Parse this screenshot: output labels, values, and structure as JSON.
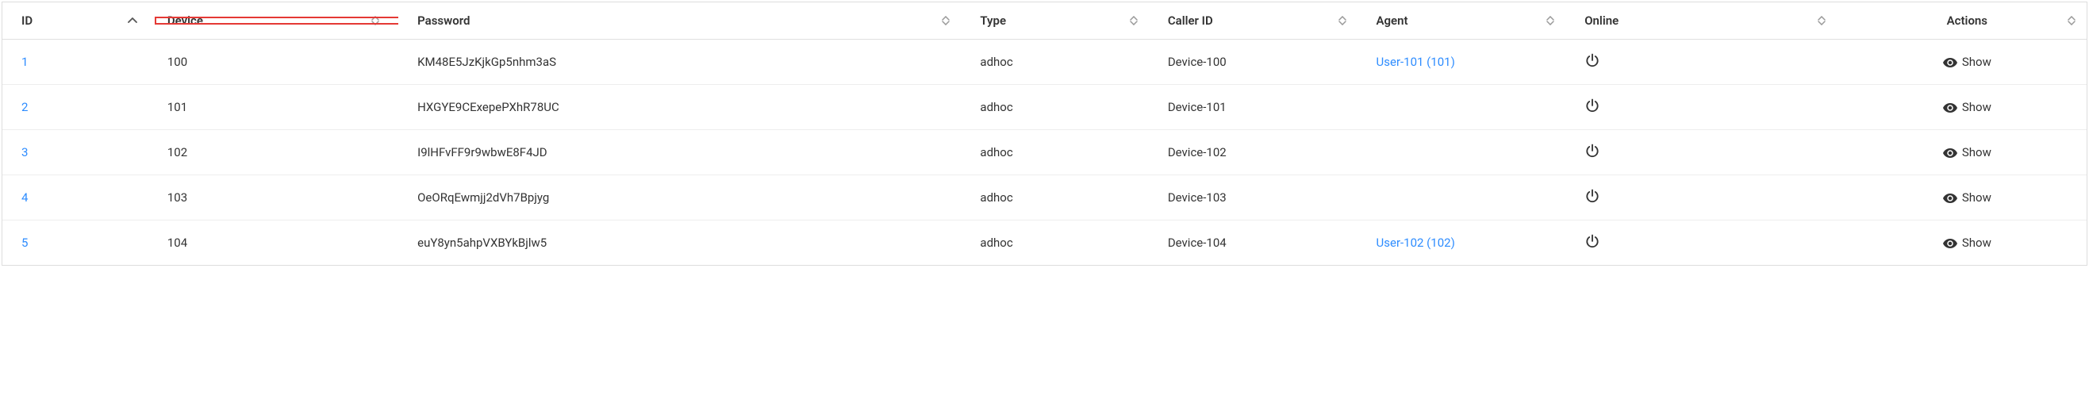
{
  "headers": {
    "id": "ID",
    "device": "Device",
    "password": "Password",
    "type": "Type",
    "callerId": "Caller ID",
    "agent": "Agent",
    "online": "Online",
    "actions": "Actions"
  },
  "rows": [
    {
      "id": "1",
      "device": "100",
      "password": "KM48E5JzKjkGp5nhm3aS",
      "type": "adhoc",
      "callerId": "Device-100",
      "agent": "User-101 (101)"
    },
    {
      "id": "2",
      "device": "101",
      "password": "HXGYE9CExepePXhR78UC",
      "type": "adhoc",
      "callerId": "Device-101",
      "agent": ""
    },
    {
      "id": "3",
      "device": "102",
      "password": "I9lHFvFF9r9wbwE8F4JD",
      "type": "adhoc",
      "callerId": "Device-102",
      "agent": ""
    },
    {
      "id": "4",
      "device": "103",
      "password": "OeORqEwmjj2dVh7Bpjyg",
      "type": "adhoc",
      "callerId": "Device-103",
      "agent": ""
    },
    {
      "id": "5",
      "device": "104",
      "password": "euY8yn5ahpVXBYkBjlw5",
      "type": "adhoc",
      "callerId": "Device-104",
      "agent": "User-102 (102)"
    }
  ],
  "actionLabel": "Show"
}
